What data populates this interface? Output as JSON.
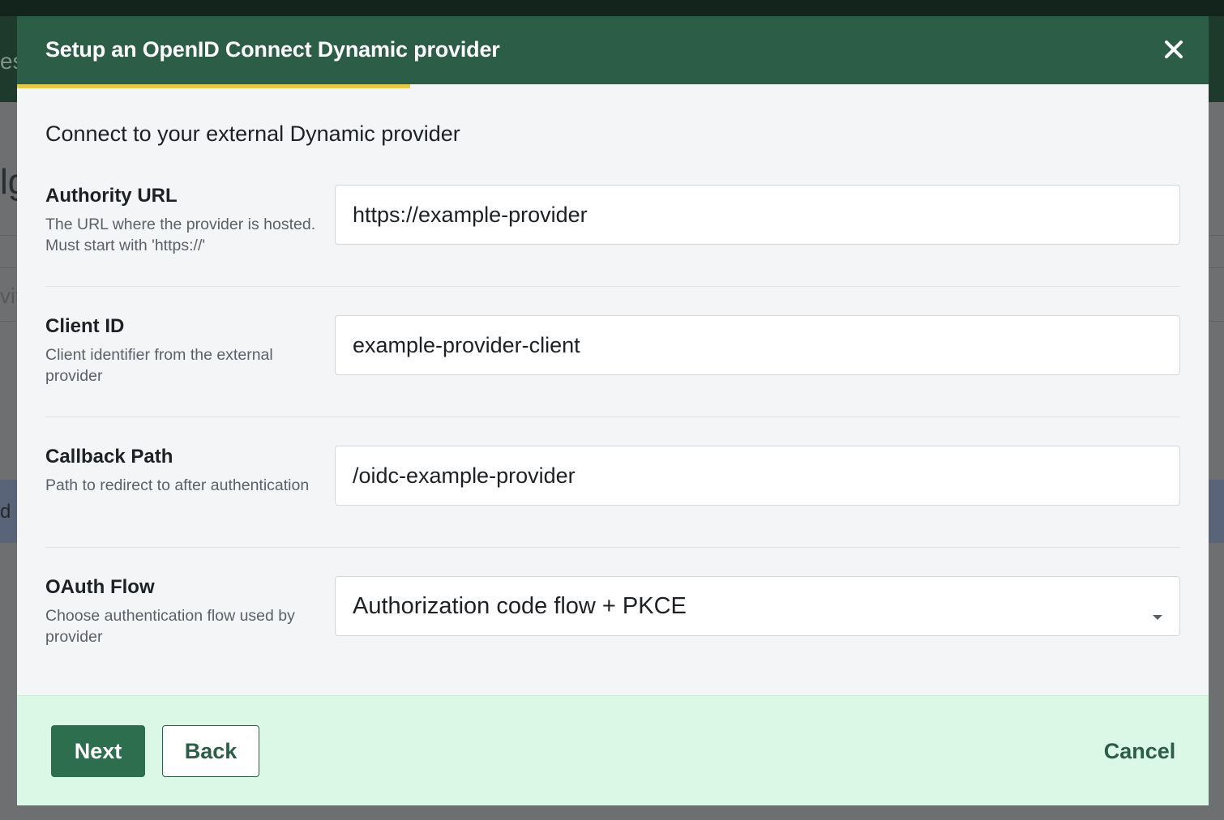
{
  "background": {
    "fragments": [
      "es",
      "lg",
      "vit",
      "d"
    ]
  },
  "modal": {
    "title": "Setup an OpenID Connect Dynamic provider",
    "close_icon": "close-icon",
    "progress_fraction": 0.33,
    "subtitle": "Connect to your external Dynamic provider",
    "fields": {
      "authority_url": {
        "label": "Authority URL",
        "help": "The URL where the provider is hosted. Must start with 'https://'",
        "value": "https://example-provider"
      },
      "client_id": {
        "label": "Client ID",
        "help": "Client identifier from the external provider",
        "value": "example-provider-client"
      },
      "callback_path": {
        "label": "Callback Path",
        "help": "Path to redirect to after authentication",
        "value": "/oidc-example-provider"
      },
      "oauth_flow": {
        "label": "OAuth Flow",
        "help": "Choose authentication flow used by provider",
        "selected": "Authorization code flow + PKCE",
        "icon": "chevron-down-icon"
      }
    },
    "footer": {
      "next_label": "Next",
      "back_label": "Back",
      "cancel_label": "Cancel"
    }
  },
  "colors": {
    "header": "#2c5e47",
    "progress": "#e7c94a",
    "footer": "#dbf7e6",
    "primary_button": "#2c6e4e"
  }
}
